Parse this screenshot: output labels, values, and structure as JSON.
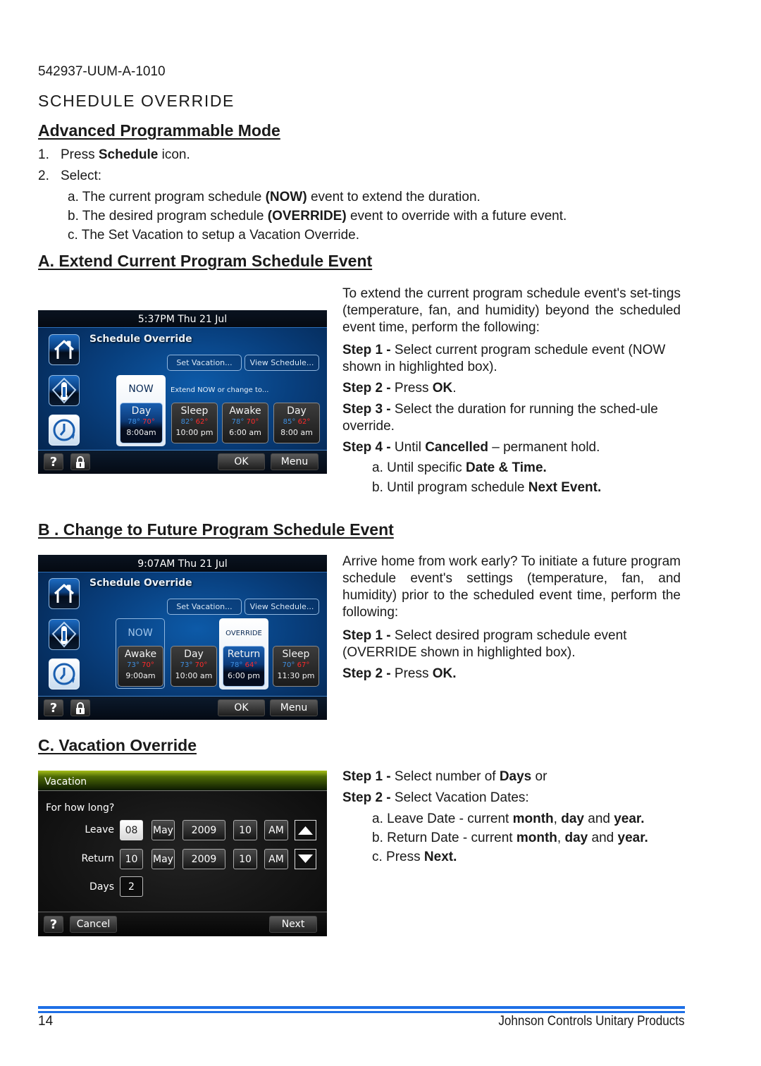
{
  "doc_id": "542937-UUM-A-1010",
  "section_title": "SCHEDULE OVERRIDE",
  "apm": {
    "heading": "Advanced Programmable Mode",
    "steps": [
      {
        "num": "1.",
        "pre": "Press ",
        "bold": "Schedule",
        "post": " icon."
      },
      {
        "num": "2.",
        "pre": "Select:",
        "bold": "",
        "post": ""
      }
    ],
    "substeps": [
      {
        "pre": "a. The current program schedule ",
        "bold": "(NOW)",
        "post": " event to extend the duration."
      },
      {
        "pre": "b. The desired program schedule ",
        "bold": "(OVERRIDE)",
        "post": " event to override with a future event."
      },
      {
        "pre": "c. The Set Vacation to setup a Vacation Override.",
        "bold": "",
        "post": ""
      }
    ]
  },
  "section_a": {
    "heading": "A. Extend Current Program Schedule Event",
    "intro": "To extend the current program schedule event's set-tings (temperature, fan, and humidity) beyond the scheduled event time, perform the following:",
    "steps": [
      {
        "label": "Step 1 - ",
        "pre": "Select current program schedule event (NOW shown in highlighted box).",
        "bold": "",
        "post": ""
      },
      {
        "label": "Step 2 - ",
        "pre": "Press ",
        "bold": "OK",
        "post": "."
      },
      {
        "label": "Step 3 - ",
        "pre": "Select the duration for running the sched-ule override.",
        "bold": "",
        "post": ""
      },
      {
        "label": "Step 4 - ",
        "pre": "Until ",
        "bold": "Cancelled",
        "post": " – permanent hold."
      }
    ],
    "substeps": [
      {
        "pre": "a. Until specific ",
        "bold": "Date & Time.",
        "post": ""
      },
      {
        "pre": "b. Until program schedule ",
        "bold": "Next Event.",
        "post": ""
      }
    ],
    "screen": {
      "clock": "5:37PM Thu 21 Jul",
      "title": "Schedule Override",
      "set_vacation": "Set Vacation...",
      "view_schedule": "View Schedule...",
      "highlight_label": "NOW",
      "hint": "Extend NOW or change to...",
      "events": [
        {
          "name": "Day",
          "cool": "78°",
          "heat": "70°",
          "time": "8:00am"
        },
        {
          "name": "Sleep",
          "cool": "82°",
          "heat": "62°",
          "time": "10:00 pm"
        },
        {
          "name": "Awake",
          "cool": "78°",
          "heat": "70°",
          "time": "6:00 am"
        },
        {
          "name": "Day",
          "cool": "85°",
          "heat": "62°",
          "time": "8:00 am"
        }
      ],
      "help": "?",
      "ok": "OK",
      "menu": "Menu"
    }
  },
  "section_b": {
    "heading": "B . Change to Future Program Schedule Event",
    "intro": "Arrive home from work early? To initiate a future program schedule event's settings (temperature, fan, and humidity) prior to the scheduled event time, perform the following:",
    "steps": [
      {
        "label": "Step 1 - ",
        "pre": "Select desired program schedule event (OVERRIDE shown in highlighted box).",
        "bold": "",
        "post": ""
      },
      {
        "label": "Step 2 - ",
        "pre": "Press ",
        "bold": "OK.",
        "post": ""
      }
    ],
    "screen": {
      "clock": "9:07AM Thu 21 Jul",
      "title": "Schedule Override",
      "set_vacation": "Set Vacation...",
      "view_schedule": "View Schedule...",
      "now_label": "NOW",
      "override_label": "OVERRIDE",
      "events": [
        {
          "name": "Awake",
          "cool": "73°",
          "heat": "70°",
          "time": "9:00am"
        },
        {
          "name": "Day",
          "cool": "73°",
          "heat": "70°",
          "time": "10:00 am"
        },
        {
          "name": "Return",
          "cool": "78°",
          "heat": "64°",
          "time": "6:00 pm"
        },
        {
          "name": "Sleep",
          "cool": "70°",
          "heat": "67°",
          "time": "11:30 pm"
        }
      ],
      "help": "?",
      "ok": "OK",
      "menu": "Menu"
    }
  },
  "section_c": {
    "heading": "C. Vacation Override",
    "steps": [
      {
        "label": "Step 1 - ",
        "pre": "Select number of ",
        "bold": "Days",
        "post": " or"
      },
      {
        "label": "Step 2 - ",
        "pre": "Select Vacation Dates:",
        "bold": "",
        "post": ""
      }
    ],
    "substeps": [
      {
        "pre": "a. Leave Date - current ",
        "b1": "month",
        "m1": ", ",
        "b2": "day",
        "m2": " and ",
        "b3": "year."
      },
      {
        "pre": "b. Return Date - current ",
        "b1": "month",
        "m1": ", ",
        "b2": "day",
        "m2": " and ",
        "b3": "year."
      },
      {
        "pre": "c. Press ",
        "b1": "Next.",
        "m1": "",
        "b2": "",
        "m2": "",
        "b3": ""
      }
    ],
    "screen": {
      "title": "Vacation",
      "question": "For how long?",
      "leave_label": "Leave",
      "leave": {
        "day": "08",
        "month": "May",
        "year": "2009",
        "hour": "10",
        "ampm": "AM"
      },
      "return_label": "Return",
      "return": {
        "day": "10",
        "month": "May",
        "year": "2009",
        "hour": "10",
        "ampm": "AM"
      },
      "days_label": "Days",
      "days": "2",
      "help": "?",
      "cancel": "Cancel",
      "next": "Next"
    }
  },
  "footer": {
    "page_number": "14",
    "company": "Johnson Controls Unitary Products",
    "rule_color": "#1e6fe6"
  }
}
